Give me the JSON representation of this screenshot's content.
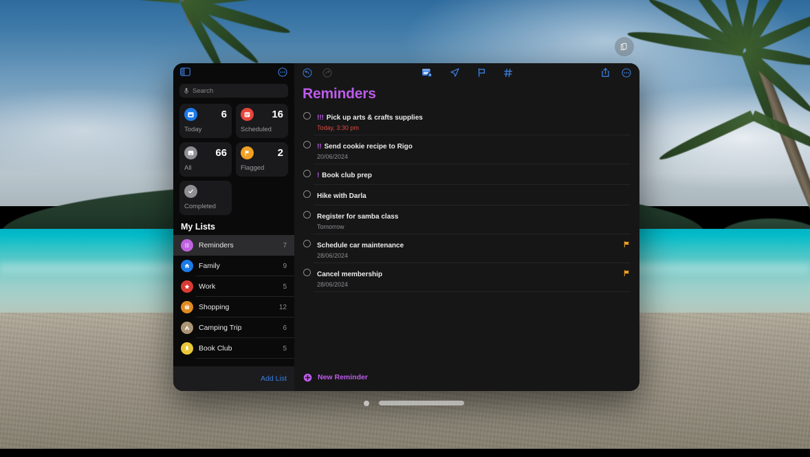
{
  "desktop": {
    "rotate_button_icon": "rotate-orientation-icon",
    "dock_handle": "window-drag-handle",
    "dock_dot": "window-dot-indicator"
  },
  "sidebar": {
    "toggle_icon": "sidebar-toggle-icon",
    "more_icon": "ellipsis-circle-icon",
    "search": {
      "placeholder": "Search",
      "mic_icon": "microphone-icon"
    },
    "smart_lists": [
      {
        "label": "Today",
        "count": "6",
        "icon": "calendar-today-icon",
        "color": "#1b7ae8"
      },
      {
        "label": "Scheduled",
        "count": "16",
        "icon": "calendar-scheduled-icon",
        "color": "#e8453c"
      },
      {
        "label": "All",
        "count": "66",
        "icon": "inbox-tray-icon",
        "color": "#8e8e93"
      },
      {
        "label": "Flagged",
        "count": "2",
        "icon": "flag-icon",
        "color": "#f0a024"
      },
      {
        "label": "Completed",
        "count": "",
        "icon": "checkmark-icon",
        "color": "#8e8e93"
      }
    ],
    "my_lists_heading": "My Lists",
    "lists": [
      {
        "name": "Reminders",
        "count": "7",
        "icon": "bullet-list-icon",
        "color": "#c062e0",
        "selected": true
      },
      {
        "name": "Family",
        "count": "9",
        "icon": "house-icon",
        "color": "#1b7ae8",
        "selected": false
      },
      {
        "name": "Work",
        "count": "5",
        "icon": "star-icon",
        "color": "#d93b32",
        "selected": false
      },
      {
        "name": "Shopping",
        "count": "12",
        "icon": "shopping-basket-icon",
        "color": "#e08a22",
        "selected": false
      },
      {
        "name": "Camping Trip",
        "count": "6",
        "icon": "tent-icon",
        "color": "#ab9573",
        "selected": false
      },
      {
        "name": "Book Club",
        "count": "5",
        "icon": "bookmark-icon",
        "color": "#e8c838",
        "selected": false
      }
    ],
    "add_list_label": "Add List"
  },
  "main": {
    "toolbar": {
      "back_icon": "undo-circle-icon",
      "forward_icon": "redo-circle-icon",
      "center_icons": [
        "add-date-reminder-icon",
        "location-arrow-icon",
        "flag-outline-icon",
        "hashtag-icon"
      ],
      "share_icon": "share-icon",
      "more_icon": "ellipsis-circle-icon"
    },
    "title": "Reminders",
    "title_color": "#bb5ce8",
    "reminders": [
      {
        "priority": "!!!",
        "title": "Pick up arts & crafts supplies",
        "sub": "Today, 3:30 pm",
        "sub_today": true,
        "flagged": false
      },
      {
        "priority": "!!",
        "title": "Send cookie recipe to Rigo",
        "sub": "20/06/2024",
        "sub_today": false,
        "flagged": false
      },
      {
        "priority": "!",
        "title": "Book club prep",
        "sub": "",
        "sub_today": false,
        "flagged": false
      },
      {
        "priority": "",
        "title": "Hike with Darla",
        "sub": "",
        "sub_today": false,
        "flagged": false
      },
      {
        "priority": "",
        "title": "Register for samba class",
        "sub": "Tomorrow",
        "sub_today": false,
        "flagged": false
      },
      {
        "priority": "",
        "title": "Schedule car maintenance",
        "sub": "28/06/2024",
        "sub_today": false,
        "flagged": true
      },
      {
        "priority": "",
        "title": "Cancel membership",
        "sub": "28/06/2024",
        "sub_today": false,
        "flagged": true
      }
    ],
    "new_reminder_label": "New Reminder",
    "new_reminder_icon": "plus-circle-icon",
    "flag_color": "#f0a024"
  }
}
